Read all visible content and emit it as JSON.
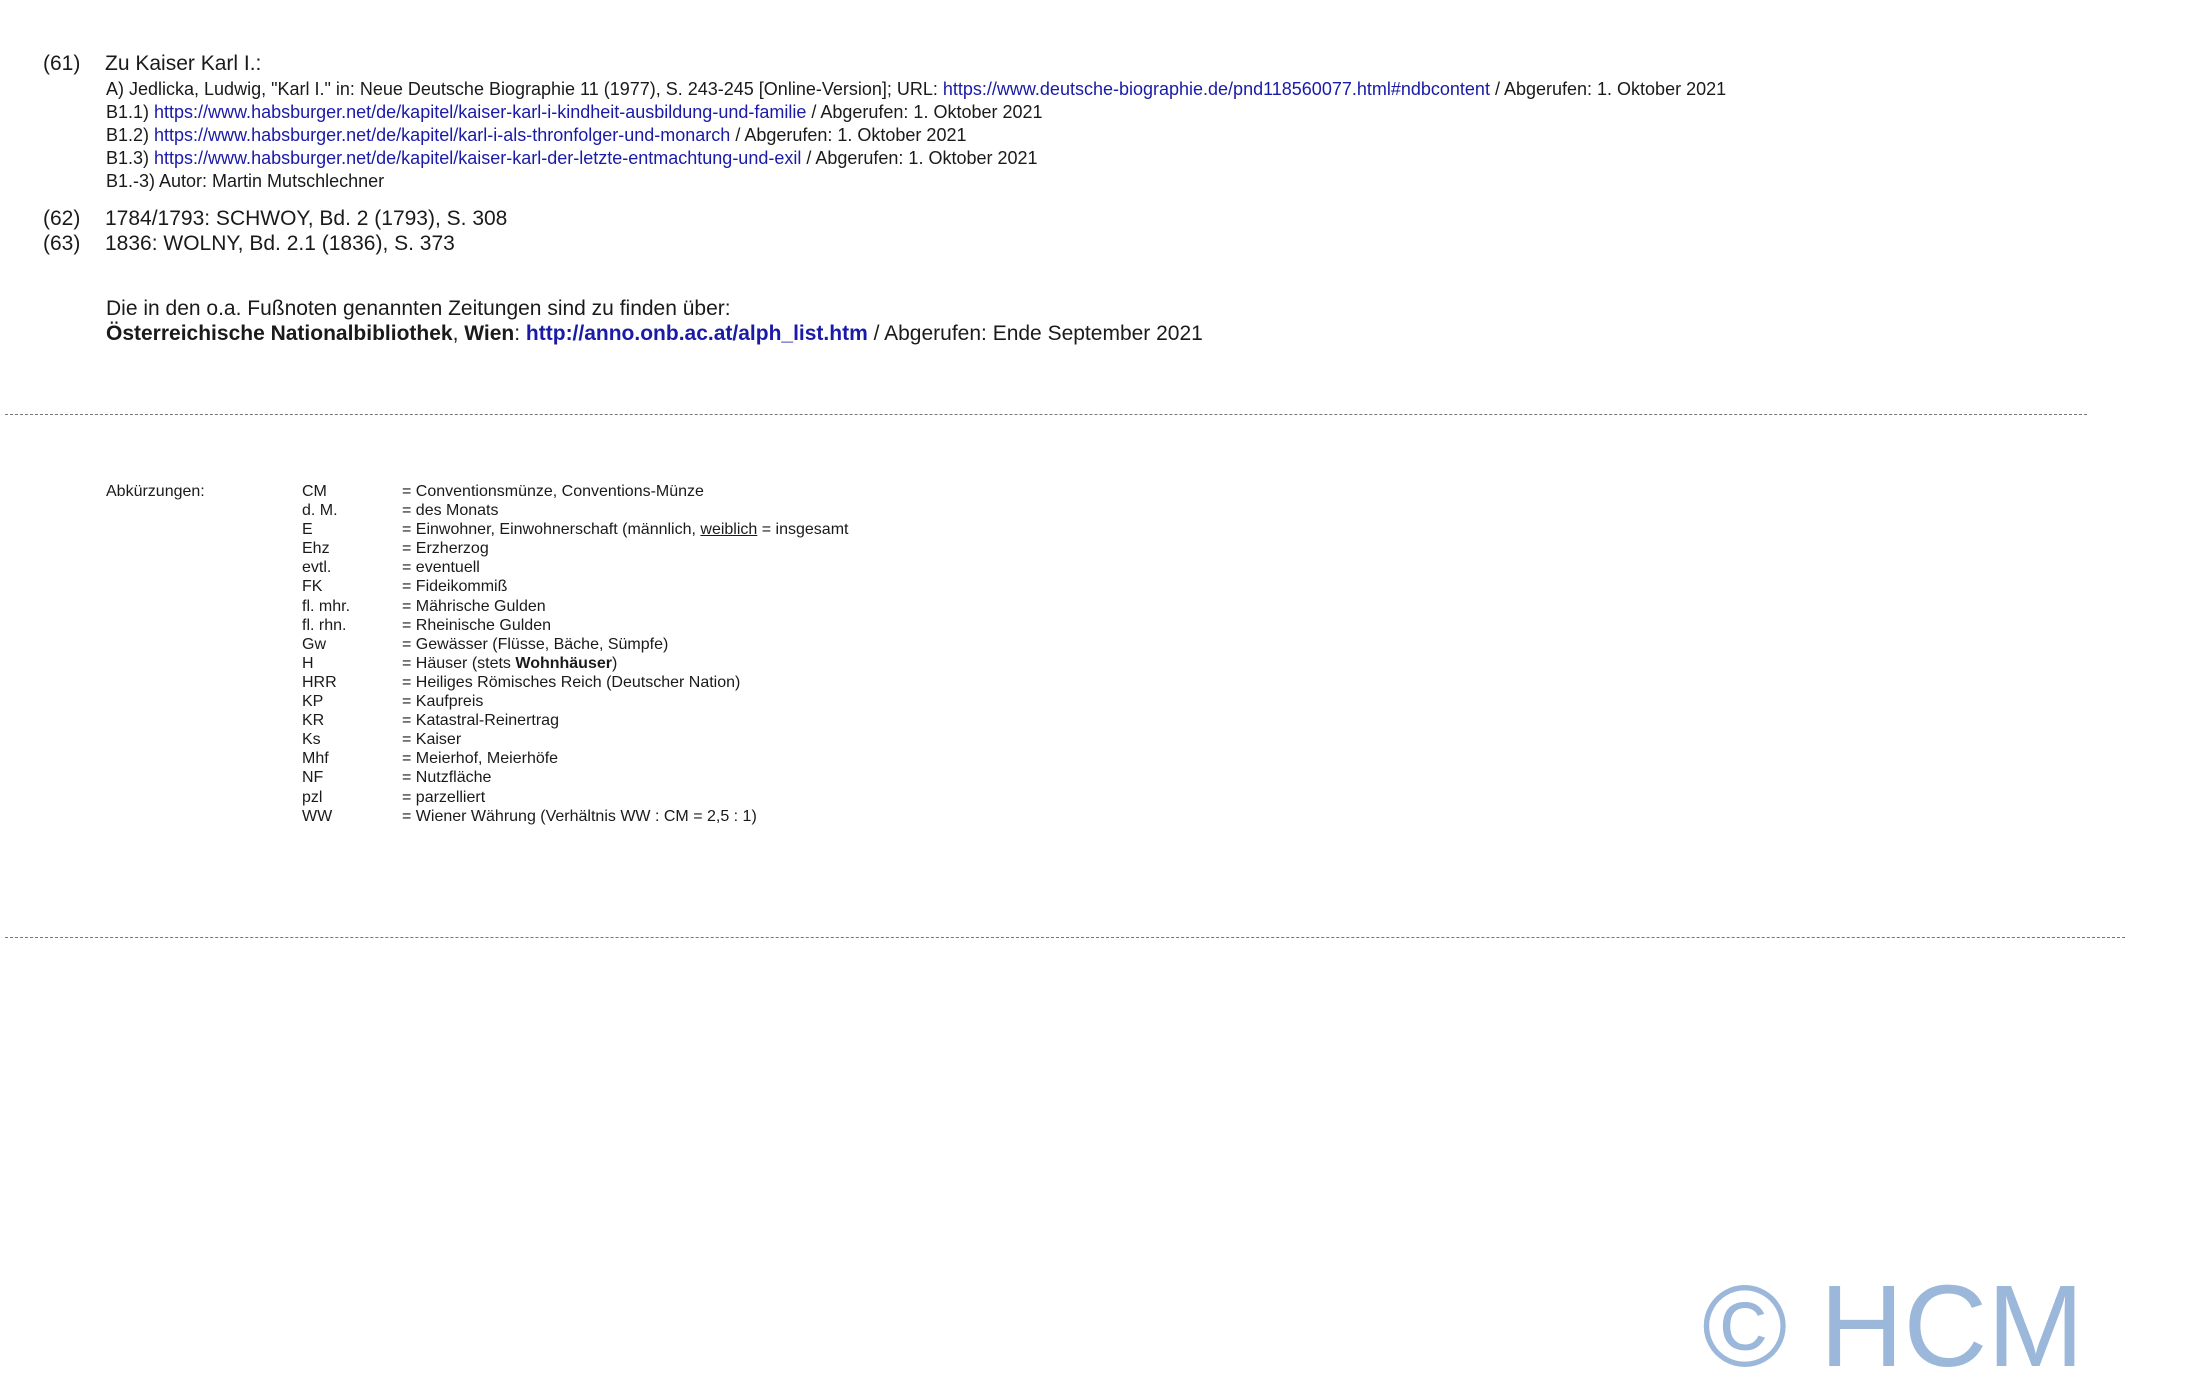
{
  "footnotes": {
    "fn61": {
      "num": "(61)",
      "title": "Zu Kaiser Karl I.:",
      "a": {
        "text": "A) Jedlicka, Ludwig, \"Karl I.\" in: Neue Deutsche Biographie 11 (1977), S. 243-245 [Online-Version]; URL: ",
        "url": "https://www.deutsche-biographie.de/pnd118560077.html#ndbcontent",
        "suffix": " / Abgerufen: 1. Oktober 2021"
      },
      "b1": {
        "prefix": "B1.1) ",
        "url": "https://www.habsburger.net/de/kapitel/kaiser-karl-i-kindheit-ausbildung-und-familie",
        "suffix": " / Abgerufen: 1. Oktober 2021"
      },
      "b2": {
        "prefix": "B1.2) ",
        "url": "https://www.habsburger.net/de/kapitel/karl-i-als-thronfolger-und-monarch",
        "suffix": " / Abgerufen: 1. Oktober 2021"
      },
      "b3": {
        "prefix": "B1.3) ",
        "url": "https://www.habsburger.net/de/kapitel/kaiser-karl-der-letzte-entmachtung-und-exil",
        "suffix": " / Abgerufen: 1. Oktober 2021"
      },
      "author": "B1.-3) Autor: Martin Mutschlechner"
    },
    "fn62": {
      "num": "(62)",
      "text": "1784/1793: SCHWOY, Bd. 2 (1793), S. 308"
    },
    "fn63": {
      "num": "(63)",
      "text": "1836: WOLNY, Bd. 2.1 (1836), S. 373"
    }
  },
  "newspaper_note": {
    "line1": "Die in den o.a. Fußnoten genannten Zeitungen sind zu finden über:",
    "library": "Österreichische Nationalbibliothek",
    "comma": ", ",
    "city": "Wien",
    "colon": ": ",
    "url": "http://anno.onb.ac.at/alph_list.htm",
    "suffix": " / Abgerufen: Ende September 2021"
  },
  "abbreviations": {
    "label": "Abkürzungen:",
    "items": [
      {
        "key": "CM",
        "value": "= Conventionsmünze, Conventions-Münze"
      },
      {
        "key": "d. M.",
        "value": "= des Monats"
      },
      {
        "key": "E",
        "value": "= Einwohner, Einwohnerschaft (männlich, ",
        "value_ul": "weiblich",
        "value_after": " = insgesamt"
      },
      {
        "key": "Ehz",
        "value": "= Erzherzog"
      },
      {
        "key": "evtl.",
        "value": "= eventuell"
      },
      {
        "key": "FK",
        "value": "= Fideikommiß"
      },
      {
        "key": "fl. mhr.",
        "value": "= Mährische Gulden"
      },
      {
        "key": "fl. rhn.",
        "value": "= Rheinische Gulden"
      },
      {
        "key": "Gw",
        "value": "= Gewässer (Flüsse, Bäche, Sümpfe)"
      },
      {
        "key": "H",
        "value": "= Häuser (stets ",
        "value_bold": "Wohnhäuser",
        "value_after": ")"
      },
      {
        "key": "HRR",
        "value": "= Heiliges Römisches Reich (Deutscher Nation)"
      },
      {
        "key": "KP",
        "value": "= Kaufpreis"
      },
      {
        "key": "KR",
        "value": "= Katastral-Reinertrag"
      },
      {
        "key": "Ks",
        "value": "= Kaiser"
      },
      {
        "key": "Mhf",
        "value": "= Meierhof, Meierhöfe"
      },
      {
        "key": "NF",
        "value": "= Nutzfläche"
      },
      {
        "key": "pzl",
        "value": "= parzelliert"
      },
      {
        "key": "WW",
        "value": "= Wiener Währung (Verhältnis WW : CM = 2,5 : 1)"
      }
    ]
  },
  "watermark": "© HCM"
}
